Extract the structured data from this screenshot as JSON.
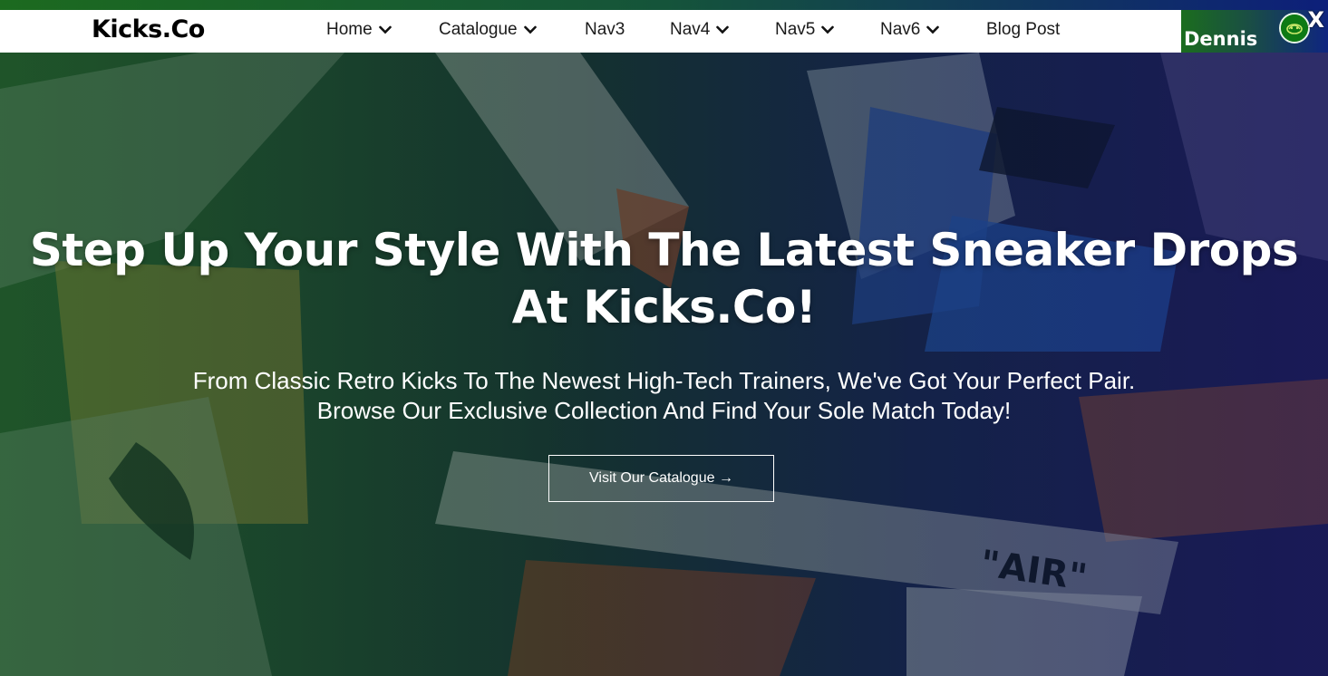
{
  "brand": {
    "name": "Kicks.Co"
  },
  "nav": {
    "items": [
      {
        "label": "Home",
        "has_dropdown": true
      },
      {
        "label": "Catalogue",
        "has_dropdown": true
      },
      {
        "label": "Nav3",
        "has_dropdown": false
      },
      {
        "label": "Nav4",
        "has_dropdown": true
      },
      {
        "label": "Nav5",
        "has_dropdown": true
      },
      {
        "label": "Nav6",
        "has_dropdown": true
      },
      {
        "label": "Blog Post",
        "has_dropdown": false
      }
    ]
  },
  "user": {
    "name": "Dennis",
    "close_label": "X",
    "avatar_icon": "avatar-icon"
  },
  "hero": {
    "title": "Step Up Your Style With The Latest Sneaker Drops At Kicks.Co!",
    "subtitle_line1": "From Classic Retro Kicks To The Newest High-Tech Trainers, We've Got Your Perfect Pair.",
    "subtitle_line2": "Browse Our Exclusive Collection And Find Your Sole Match Today!",
    "cta_label": "Visit Our Catalogue →",
    "background_icon": "sneakers-photo"
  },
  "colors": {
    "accent_green": "#1b6d1e",
    "accent_blue": "#0f2580",
    "text_dark": "#1a1a1a",
    "nav_bg": "#ffffff"
  }
}
